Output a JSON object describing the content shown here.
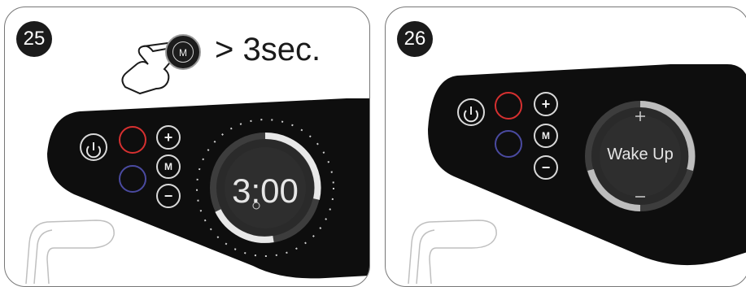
{
  "panel_25": {
    "step": "25",
    "hold_instruction": "> 3sec.",
    "hand_button_label": "M",
    "display_time": "3:00",
    "buttons": {
      "plus": "+",
      "mode": "M",
      "minus": "−"
    }
  },
  "panel_26": {
    "step": "26",
    "display_text": "Wake Up",
    "buttons": {
      "plus": "+",
      "mode": "M",
      "minus": "−"
    },
    "dial_plus": "+",
    "dial_minus": "−"
  }
}
